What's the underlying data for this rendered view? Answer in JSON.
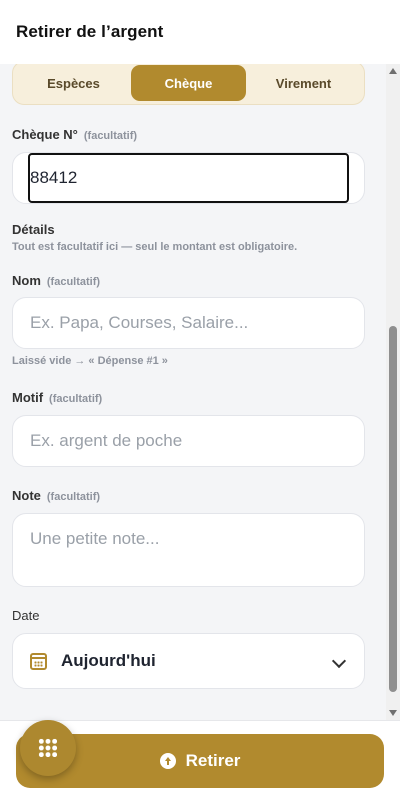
{
  "header": {
    "title": "Retirer de l’argent"
  },
  "method_tabs": [
    {
      "label": "Espèces",
      "active": false
    },
    {
      "label": "Chèque",
      "active": true
    },
    {
      "label": "Virement",
      "active": false
    }
  ],
  "cheque": {
    "label": "Chèque N°",
    "optional": "(facultatif)",
    "value": "88412"
  },
  "details": {
    "title": "Détails",
    "hint": "Tout est facultatif ici — seul le montant est obligatoire."
  },
  "nom": {
    "label": "Nom",
    "optional": "(facultatif)",
    "placeholder": "Ex. Papa, Courses, Salaire...",
    "hint": "Laissé vide → « Dépense #1 »"
  },
  "motif": {
    "label": "Motif",
    "optional": "(facultatif)",
    "placeholder": "Ex. argent de poche"
  },
  "note": {
    "label": "Note",
    "optional": "(facultatif)",
    "placeholder": "Une petite note..."
  },
  "date": {
    "label": "Date",
    "value": "Aujourd'hui"
  },
  "footer": {
    "withdraw_label": "Retirer"
  },
  "icons": {
    "calendar": "calendar-icon",
    "chevron": "chevron-down-icon",
    "withdraw": "arrow-up-circle-icon",
    "menu": "grid-dots-icon"
  },
  "colors": {
    "accent": "#b18a2e",
    "accent_light": "#f7efdc",
    "background": "#f4f5f7"
  }
}
